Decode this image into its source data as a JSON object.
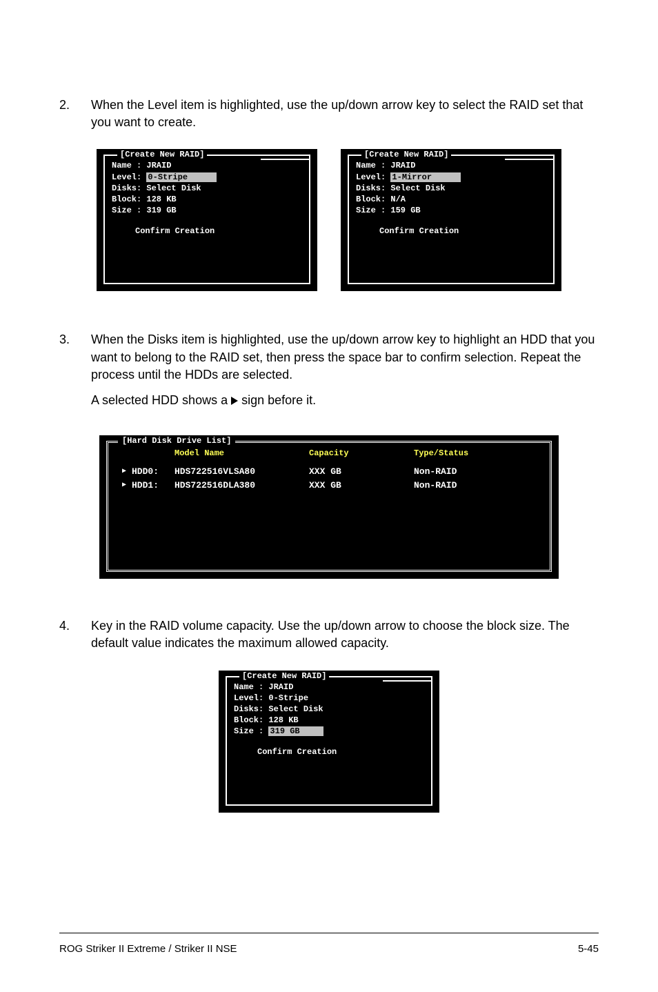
{
  "step2": {
    "num": "2.",
    "text": "When the Level item is highlighted, use the up/down arrow key to select the RAID set that you want to create."
  },
  "panelA": {
    "title": "[Create New RAID]",
    "name": "Name : JRAID",
    "level_label": "Level: ",
    "level_value": "0-Stripe",
    "disks": "Disks: Select Disk",
    "block": "Block: 128 KB",
    "size": "Size : 319 GB",
    "confirm": "Confirm Creation"
  },
  "panelB": {
    "title": "[Create New RAID]",
    "name": "Name : JRAID",
    "level_label": "Level: ",
    "level_value": "1-Mirror",
    "disks": "Disks: Select Disk",
    "block": "Block: N/A",
    "size": "Size : 159 GB",
    "confirm": "Confirm Creation"
  },
  "step3": {
    "num": "3.",
    "text1": "When the Disks item is highlighted, use the up/down arrow key to highlight an HDD that you want to belong to the RAID set, then press the space bar to confirm selection. Repeat the process until the HDDs are selected.",
    "text2a": "A selected HDD shows a",
    "text2b": "sign before it."
  },
  "hdd_panel": {
    "title": "[Hard Disk Drive List]",
    "col_model": "Model Name",
    "col_capacity": "Capacity",
    "col_type": "Type/Status",
    "rows": [
      {
        "id": "HDD0:",
        "model": "HDS722516VLSA80",
        "cap": "XXX GB",
        "status": "Non-RAID"
      },
      {
        "id": "HDD1:",
        "model": "HDS722516DLA380",
        "cap": "XXX GB",
        "status": "Non-RAID"
      }
    ]
  },
  "step4": {
    "num": "4.",
    "text": "Key in the RAID volume capacity. Use the up/down arrow to choose the block size. The default value indicates the maximum allowed capacity."
  },
  "panelC": {
    "title": "[Create New RAID]",
    "name": "Name : JRAID",
    "level": "Level: 0-Stripe",
    "disks": "Disks: Select Disk",
    "block": "Block: 128 KB",
    "size_label": "Size : ",
    "size_value": "319 GB",
    "confirm": "Confirm Creation"
  },
  "footer": {
    "left": "ROG Striker II Extreme / Striker II NSE",
    "right": "5-45"
  }
}
